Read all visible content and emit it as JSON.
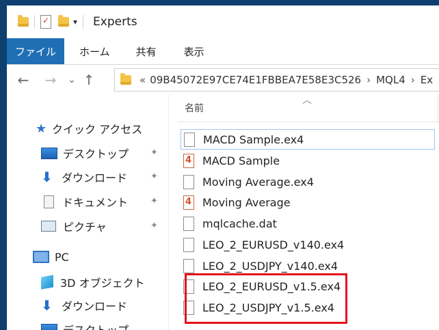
{
  "window": {
    "title": "Experts"
  },
  "ribbon": {
    "tabs": [
      "ファイル",
      "ホーム",
      "共有",
      "表示"
    ]
  },
  "address": {
    "prefix": "«",
    "segments": [
      "09B45072E97CE74E1FBBEA7E58E3C526",
      "MQL4",
      "Ex"
    ]
  },
  "navpane": {
    "quick_access": "クイック アクセス",
    "quick_items": [
      "デスクトップ",
      "ダウンロード",
      "ドキュメント",
      "ピクチャ"
    ],
    "pc": "PC",
    "pc_items": [
      "3D オブジェクト",
      "ダウンロード",
      "デスクトップ"
    ]
  },
  "filelist": {
    "column_name": "名前",
    "files": [
      {
        "name": "MACD Sample.ex4",
        "icon": "file-icon"
      },
      {
        "name": "MACD Sample",
        "icon": "mq4-source-icon"
      },
      {
        "name": "Moving Average.ex4",
        "icon": "file-icon"
      },
      {
        "name": "Moving Average",
        "icon": "mq4-source-icon"
      },
      {
        "name": "mqlcache.dat",
        "icon": "file-icon"
      },
      {
        "name": "LEO_2_EURUSD_v140.ex4",
        "icon": "file-icon"
      },
      {
        "name": "LEO_2_USDJPY_v140.ex4",
        "icon": "file-icon"
      },
      {
        "name": "LEO_2_EURUSD_v1.5.ex4",
        "icon": "file-icon"
      },
      {
        "name": "LEO_2_USDJPY_v1.5.ex4",
        "icon": "file-icon"
      }
    ]
  },
  "colors": {
    "file_tab": "#1f6fb5",
    "highlight": "#e4111d",
    "desktop_bg": "#0f3f6e"
  }
}
